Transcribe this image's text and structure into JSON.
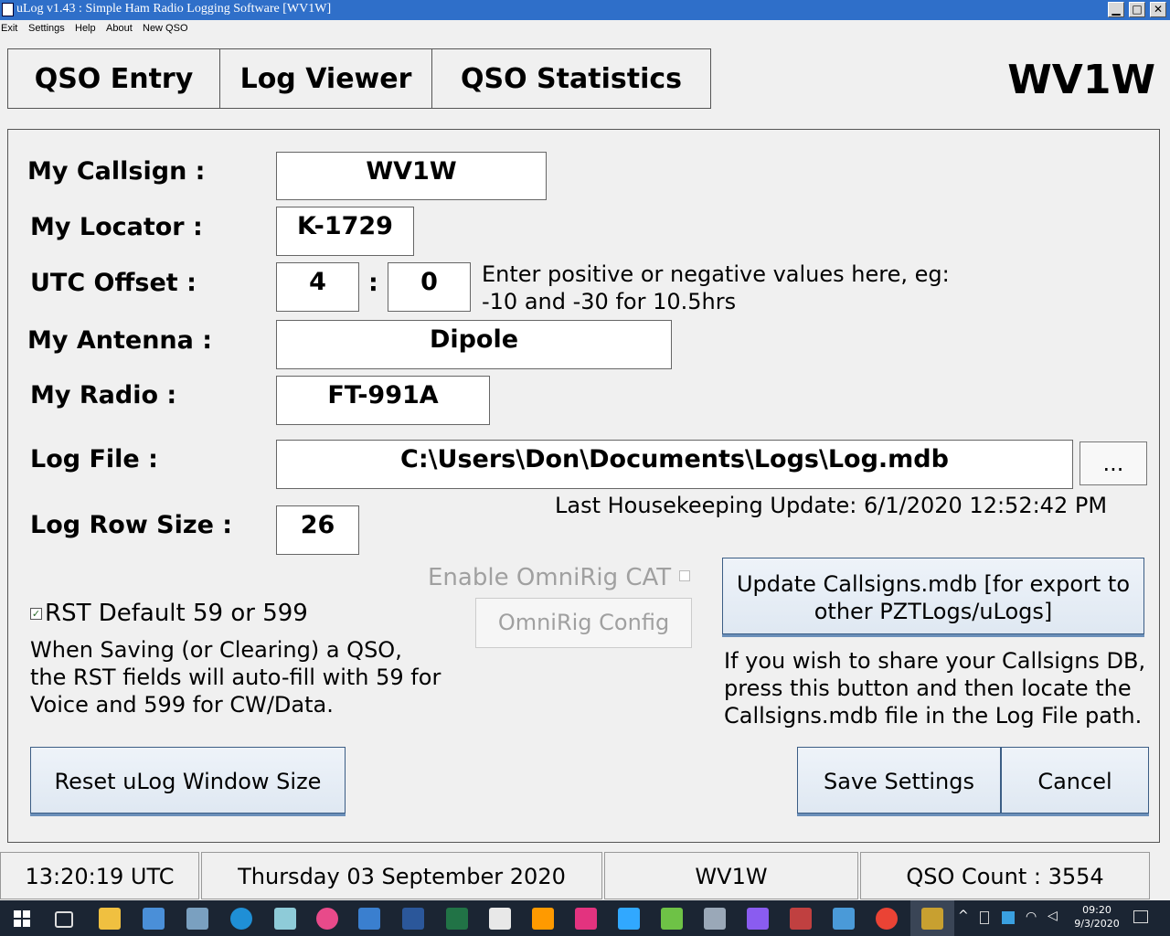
{
  "window": {
    "title": "uLog v1.43 : Simple Ham Radio Logging Software    [WV1W]",
    "minimize": "▁",
    "maximize": "□",
    "close": "✕"
  },
  "menu": [
    "Exit",
    "Settings",
    "Help",
    "About",
    "New QSO"
  ],
  "tabs": [
    "QSO Entry",
    "Log Viewer",
    "QSO Statistics"
  ],
  "header_callsign": "WV1W",
  "settings": {
    "callsign_label": "My Callsign  :",
    "callsign": "WV1W",
    "locator_label": "My Locator :",
    "locator": "K-1729",
    "utc_label": "UTC Offset  :",
    "utc_hours": "4",
    "utc_sep": ":",
    "utc_minutes": "0",
    "utc_hint_1": "Enter positive or negative values here, eg:",
    "utc_hint_2": "-10 and -30 for 10.5hrs",
    "antenna_label": "My Antenna :",
    "antenna": "Dipole",
    "radio_label": "My Radio :",
    "radio": "FT-991A",
    "logfile_label": "Log File  :",
    "logfile": "C:\\Users\\Don\\Documents\\Logs\\Log.mdb",
    "browse": "...",
    "housekeeping": "Last Housekeeping Update: 6/1/2020 12:52:42 PM",
    "rowsize_label": "Log Row Size :",
    "rowsize": "26",
    "omnirig_label": "Enable OmniRig CAT",
    "omnirig_config": "OmniRig Config",
    "rst_label": "RST Default 59 or 599",
    "rst_desc_1": "When Saving (or Clearing) a QSO,",
    "rst_desc_2": "the RST fields will auto-fill with 59 for",
    "rst_desc_3": "Voice and 599 for CW/Data.",
    "update_btn_1": "Update Callsigns.mdb [for export to",
    "update_btn_2": "other PZTLogs/uLogs]",
    "share_1": "If you wish to share your Callsigns DB,",
    "share_2": "press this button and then locate the",
    "share_3": "Callsigns.mdb file in the Log File path.",
    "reset_btn": "Reset uLog Window Size",
    "save_btn": "Save Settings",
    "cancel_btn": "Cancel"
  },
  "status": {
    "utc_time": "13:20:19  UTC",
    "date": "Thursday 03 September 2020",
    "callsign": "WV1W",
    "qso_count": "QSO Count : 3554"
  },
  "taskbar": {
    "time": "09:20",
    "date": "9/3/2020"
  },
  "colors": {
    "titlebar": "#2f6fc9",
    "taskbar": "#1b2533",
    "button_border": "#3b5d85"
  }
}
